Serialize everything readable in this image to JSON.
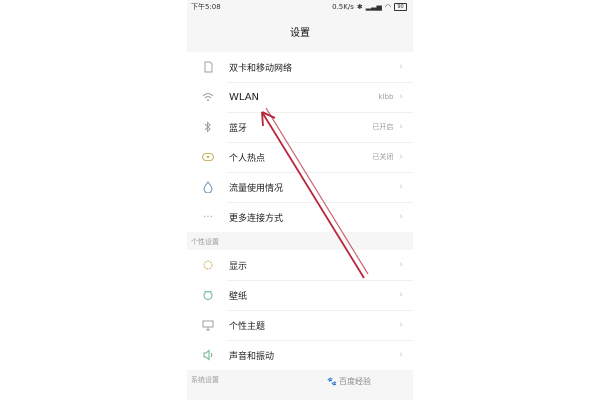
{
  "status_bar": {
    "time": "下午5:08",
    "network_speed": "0.5K/s",
    "battery": "90"
  },
  "header": {
    "title": "设置"
  },
  "connection_group": [
    {
      "icon": "sim-card-icon",
      "label": "双卡和移动网络",
      "value": ""
    },
    {
      "icon": "wifi-icon",
      "label": "WLAN",
      "value": "klbb"
    },
    {
      "icon": "bluetooth-icon",
      "label": "蓝牙",
      "value": "已开启"
    },
    {
      "icon": "hotspot-icon",
      "label": "个人热点",
      "value": "已关闭"
    },
    {
      "icon": "data-usage-icon",
      "label": "流量使用情况",
      "value": ""
    },
    {
      "icon": "more-icon",
      "label": "更多连接方式",
      "value": ""
    }
  ],
  "personalization_section": {
    "title": "个性设置"
  },
  "personalization_group": [
    {
      "icon": "display-icon",
      "label": "显示"
    },
    {
      "icon": "wallpaper-icon",
      "label": "壁纸"
    },
    {
      "icon": "theme-icon",
      "label": "个性主题"
    },
    {
      "icon": "sound-icon",
      "label": "声音和振动"
    }
  ],
  "system_section": {
    "title": "系统设置"
  },
  "watermark": {
    "text": "百度经验"
  },
  "colors": {
    "annotation_arrow": "#b8243a",
    "background": "#f6f6f6",
    "row_bg": "#ffffff"
  }
}
